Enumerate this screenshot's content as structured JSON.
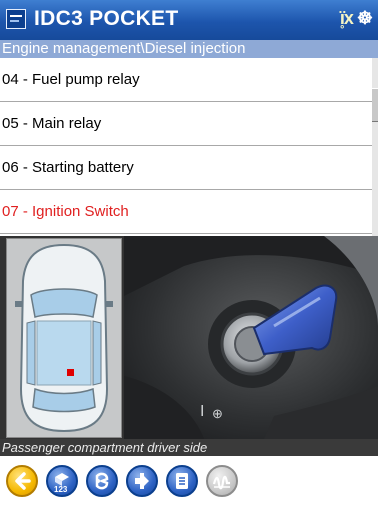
{
  "titlebar": {
    "title": "IDC3 POCKET",
    "status_icons": [
      "connection-icon",
      "settings-icon"
    ]
  },
  "breadcrumb": "Engine management\\Diesel injection",
  "list": {
    "items": [
      {
        "label": "04 - Fuel pump relay",
        "selected": false
      },
      {
        "label": "05 - Main relay",
        "selected": false
      },
      {
        "label": "06 - Starting battery",
        "selected": false
      },
      {
        "label": "07 - Ignition Switch",
        "selected": true
      }
    ]
  },
  "location": {
    "caption": "Passenger compartment driver side",
    "marker_color": "#e00000"
  },
  "toolbar": {
    "buttons": [
      "back-icon",
      "component-icon",
      "connector-icon",
      "pin-icon",
      "document-icon",
      "waveform-icon"
    ]
  },
  "colors": {
    "title_bar": "#1d55ad",
    "breadcrumb": "#8ea9d6",
    "selected_text": "#e02020",
    "back_button": "#f5b800"
  }
}
